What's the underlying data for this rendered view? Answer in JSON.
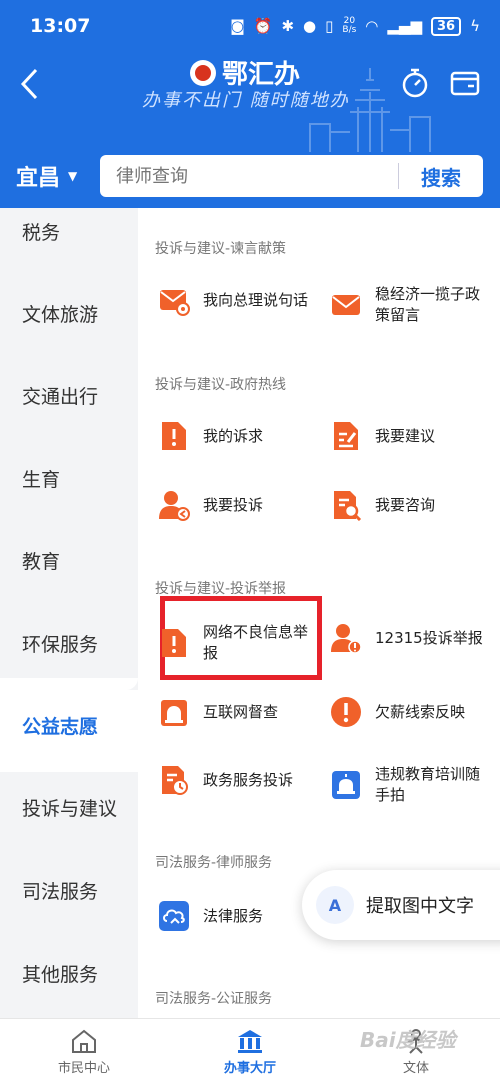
{
  "status_bar": {
    "time": "13:07",
    "speed_value": "20",
    "speed_unit": "B/s",
    "battery": "36"
  },
  "header": {
    "app_name": "鄂汇办",
    "slogan": "办事不出门 随时随地办",
    "city": "宜昌",
    "search_placeholder": "律师查询",
    "search_button": "搜索"
  },
  "sidebar": {
    "items": [
      {
        "label": "税务"
      },
      {
        "label": "文体旅游"
      },
      {
        "label": "交通出行"
      },
      {
        "label": "生育"
      },
      {
        "label": "教育"
      },
      {
        "label": "环保服务"
      },
      {
        "label": "公益志愿"
      },
      {
        "label": "投诉与建议"
      },
      {
        "label": "司法服务"
      },
      {
        "label": "其他服务"
      }
    ]
  },
  "sections": [
    {
      "title": "投诉与建议-谏言献策",
      "items": [
        {
          "label": "我向总理说句话",
          "icon": "mail-envelope-icon"
        },
        {
          "label": "稳经济一揽子政策留言",
          "icon": "envelope-icon"
        }
      ]
    },
    {
      "title": "投诉与建议-政府热线",
      "items": [
        {
          "label": "我的诉求",
          "icon": "document-alert-icon"
        },
        {
          "label": "我要建议",
          "icon": "document-edit-icon"
        },
        {
          "label": "我要投诉",
          "icon": "user-complaint-icon"
        },
        {
          "label": "我要咨询",
          "icon": "document-search-icon"
        }
      ]
    },
    {
      "title": "投诉与建议-投诉举报",
      "items": [
        {
          "label": "网络不良信息举报",
          "icon": "document-alert-icon"
        },
        {
          "label": "12315投诉举报",
          "icon": "user-alert-icon"
        },
        {
          "label": "互联网督查",
          "icon": "alarm-light-icon"
        },
        {
          "label": "欠薪线索反映",
          "icon": "exclamation-circle-icon"
        },
        {
          "label": "政务服务投诉",
          "icon": "document-clock-icon"
        },
        {
          "label": "违规教育培训随手拍",
          "icon": "camera-alarm-icon"
        }
      ]
    },
    {
      "title": "司法服务-律师服务",
      "items": [
        {
          "label": "法律服务",
          "icon": "cloud-service-icon"
        }
      ]
    },
    {
      "title": "司法服务-公证服务",
      "items": []
    }
  ],
  "ocr_button": {
    "label": "提取图中文字",
    "icon_text": "A"
  },
  "bottom_nav": [
    {
      "label": "市民中心",
      "active": false
    },
    {
      "label": "办事大厅",
      "active": true
    },
    {
      "label": "文体",
      "active": false
    }
  ],
  "watermark": "Bai度经验",
  "colors": {
    "primary": "#1f6fe0",
    "icon_orange": "#f0612a",
    "highlight_red": "#e6222a",
    "icon_blue": "#2f74e3"
  }
}
